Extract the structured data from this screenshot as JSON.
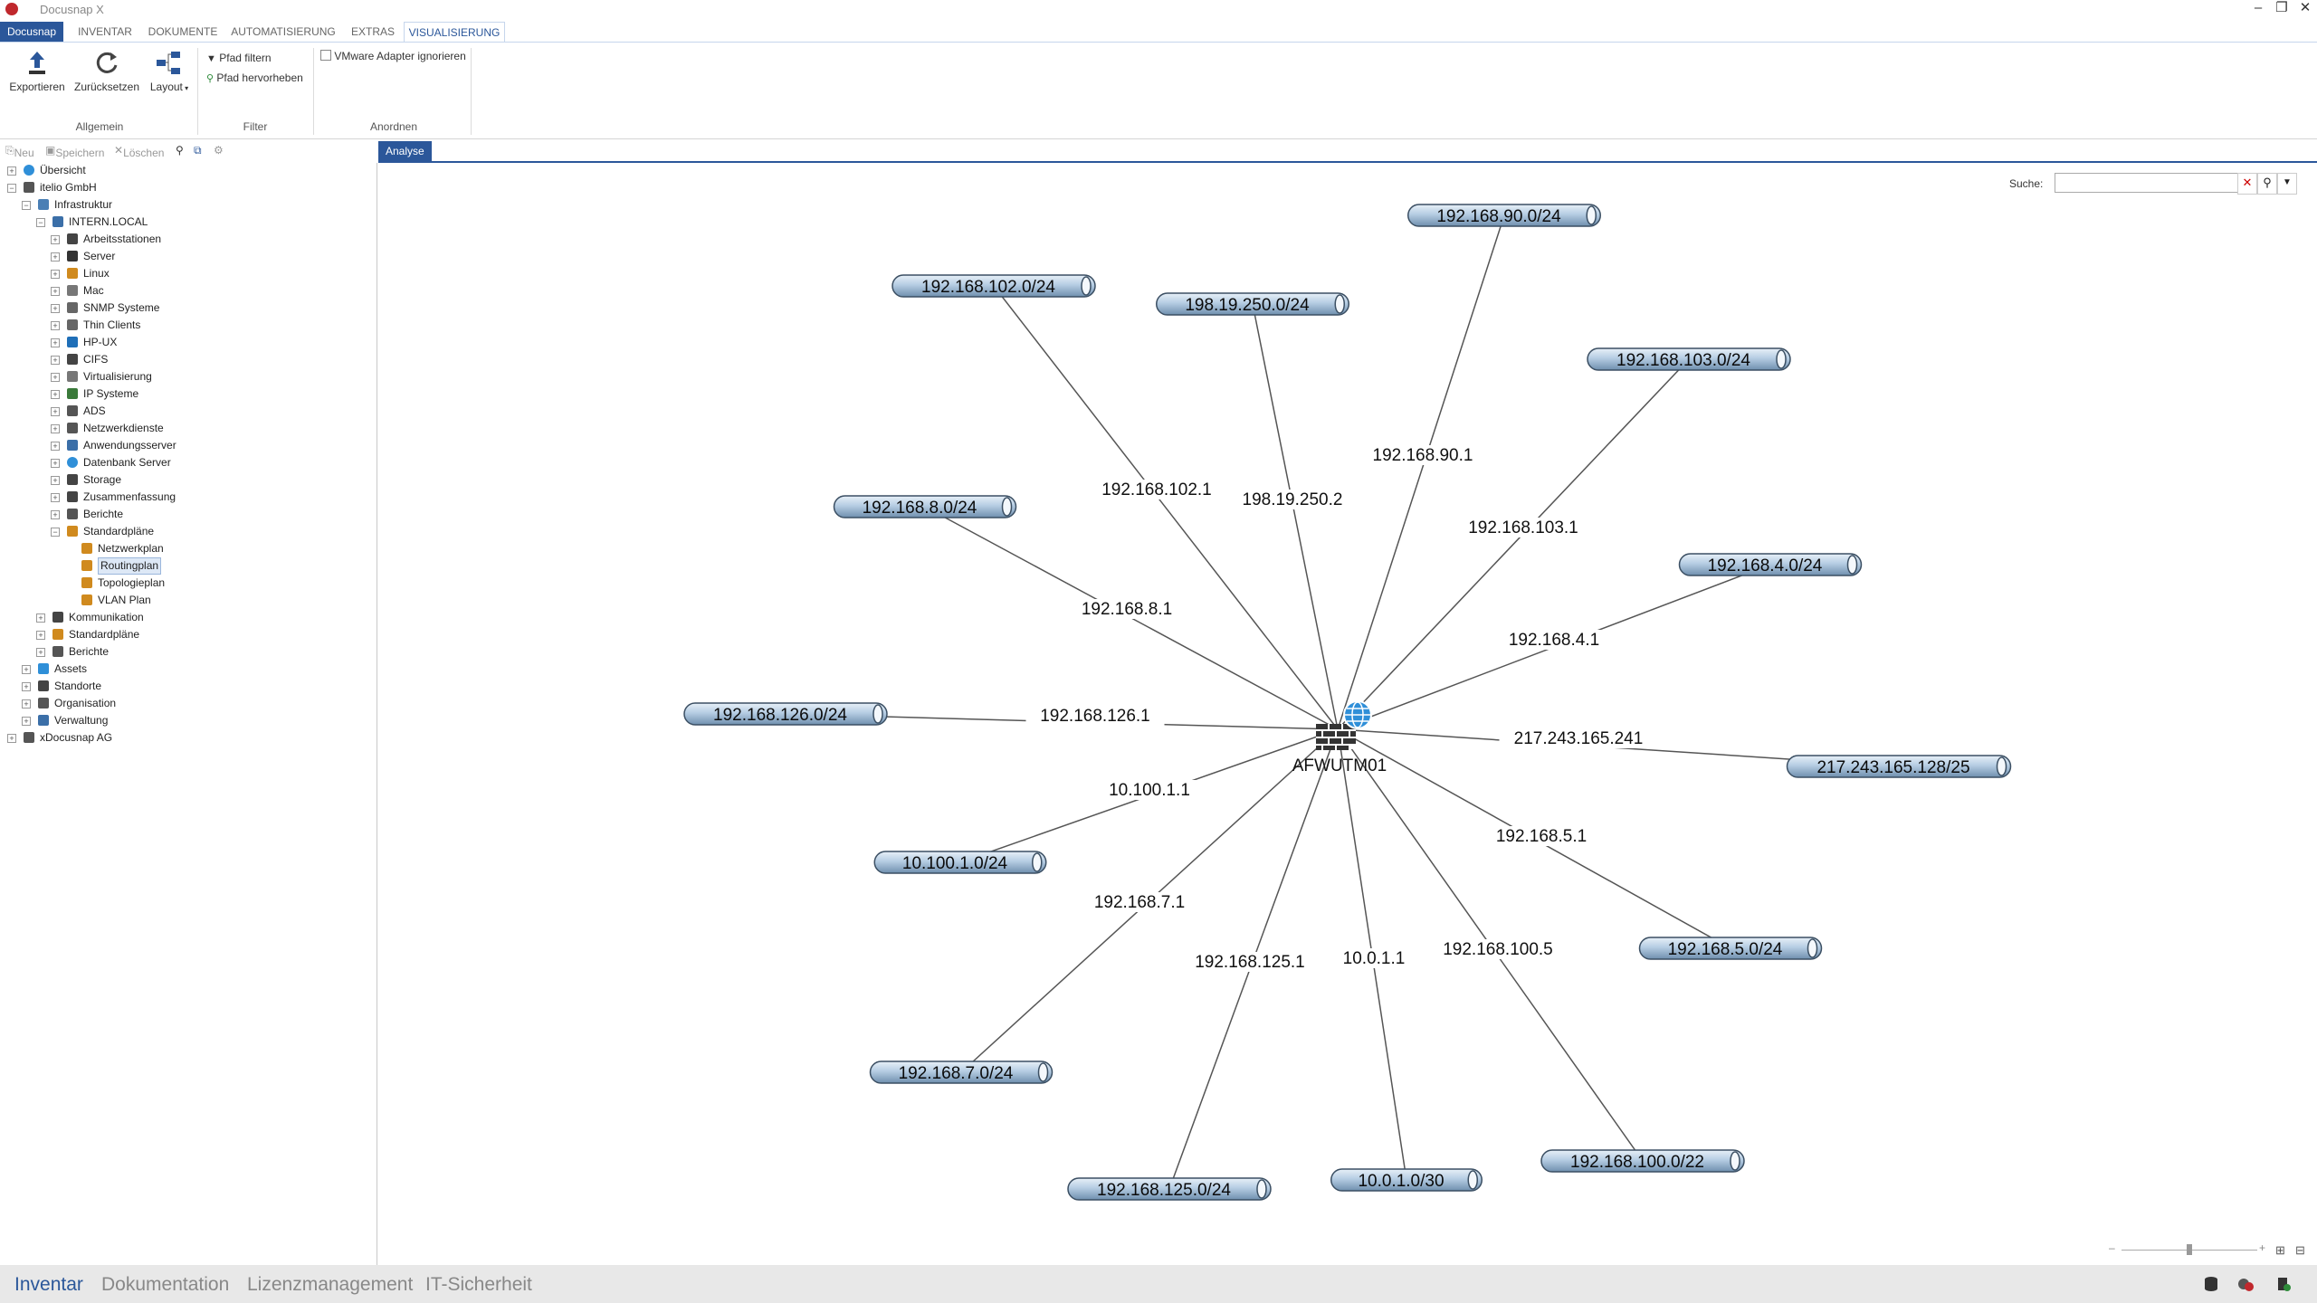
{
  "window": {
    "title": "Docusnap X"
  },
  "ribbon": {
    "tabs": [
      "Docusnap",
      "INVENTAR",
      "DOKUMENTE",
      "AUTOMATISIERUNG",
      "EXTRAS",
      "VISUALISIERUNG"
    ],
    "active_tab": "VISUALISIERUNG",
    "export_label": "Exportieren",
    "reset_label": "Zurücksetzen",
    "layout_label": "Layout",
    "filter_path_label": "Pfad filtern",
    "highlight_path_label": "Pfad hervorheben",
    "vmware_label": "VMware Adapter ignorieren",
    "vmware_checked": false,
    "group_general": "Allgemein",
    "group_filter": "Filter",
    "group_arrange": "Anordnen"
  },
  "tree_toolbar": {
    "new": "Neu",
    "save": "Speichern",
    "delete": "Löschen"
  },
  "tree": [
    {
      "label": "Übersicht",
      "icon": "globe-icon",
      "level": 0,
      "exp": "+"
    },
    {
      "label": "itelio GmbH",
      "icon": "building-icon",
      "level": 0,
      "exp": "-"
    },
    {
      "label": "Infrastruktur",
      "icon": "network-icon",
      "level": 1,
      "exp": "-"
    },
    {
      "label": "INTERN.LOCAL",
      "icon": "domain-icon",
      "level": 2,
      "exp": "-"
    },
    {
      "label": "Arbeitsstationen",
      "icon": "workstation-icon",
      "level": 3,
      "exp": "+"
    },
    {
      "label": "Server",
      "icon": "server-icon",
      "level": 3,
      "exp": "+"
    },
    {
      "label": "Linux",
      "icon": "linux-icon",
      "level": 3,
      "exp": "+"
    },
    {
      "label": "Mac",
      "icon": "mac-icon",
      "level": 3,
      "exp": "+"
    },
    {
      "label": "SNMP Systeme",
      "icon": "snmp-icon",
      "level": 3,
      "exp": "+"
    },
    {
      "label": "Thin Clients",
      "icon": "thin-client-icon",
      "level": 3,
      "exp": "+"
    },
    {
      "label": "HP-UX",
      "icon": "hp-icon",
      "level": 3,
      "exp": "+"
    },
    {
      "label": "CIFS",
      "icon": "cifs-icon",
      "level": 3,
      "exp": "+"
    },
    {
      "label": "Virtualisierung",
      "icon": "virtualization-icon",
      "level": 3,
      "exp": "+"
    },
    {
      "label": "IP Systeme",
      "icon": "ip-icon",
      "level": 3,
      "exp": "+"
    },
    {
      "label": "ADS",
      "icon": "ads-icon",
      "level": 3,
      "exp": "+"
    },
    {
      "label": "Netzwerkdienste",
      "icon": "network-services-icon",
      "level": 3,
      "exp": "+"
    },
    {
      "label": "Anwendungsserver",
      "icon": "app-server-icon",
      "level": 3,
      "exp": "+"
    },
    {
      "label": "Datenbank Server",
      "icon": "database-icon",
      "level": 3,
      "exp": "+"
    },
    {
      "label": "Storage",
      "icon": "storage-icon",
      "level": 3,
      "exp": "+"
    },
    {
      "label": "Zusammenfassung",
      "icon": "summary-icon",
      "level": 3,
      "exp": "+"
    },
    {
      "label": "Berichte",
      "icon": "report-icon",
      "level": 3,
      "exp": "+"
    },
    {
      "label": "Standardpläne",
      "icon": "plan-icon",
      "level": 3,
      "exp": "-"
    },
    {
      "label": "Netzwerkplan",
      "icon": "plan-icon",
      "level": 4,
      "exp": ""
    },
    {
      "label": "Routingplan",
      "icon": "plan-icon",
      "level": 4,
      "exp": "",
      "selected": true
    },
    {
      "label": "Topologieplan",
      "icon": "plan-icon",
      "level": 4,
      "exp": ""
    },
    {
      "label": "VLAN Plan",
      "icon": "plan-icon",
      "level": 4,
      "exp": ""
    },
    {
      "label": "Kommunikation",
      "icon": "share-icon",
      "level": 2,
      "exp": "+"
    },
    {
      "label": "Standardpläne",
      "icon": "plan-icon",
      "level": 2,
      "exp": "+"
    },
    {
      "label": "Berichte",
      "icon": "report-icon",
      "level": 2,
      "exp": "+"
    },
    {
      "label": "Assets",
      "icon": "assets-icon",
      "level": 1,
      "exp": "+"
    },
    {
      "label": "Standorte",
      "icon": "location-icon",
      "level": 1,
      "exp": "+"
    },
    {
      "label": "Organisation",
      "icon": "organization-icon",
      "level": 1,
      "exp": "+"
    },
    {
      "label": "Verwaltung",
      "icon": "admin-icon",
      "level": 1,
      "exp": "+"
    },
    {
      "label": "xDocusnap AG",
      "icon": "building-icon",
      "level": 0,
      "exp": "+"
    }
  ],
  "content": {
    "tab": "Analyse",
    "search_label": "Suche:",
    "search_value": ""
  },
  "diagram": {
    "center": {
      "label": "AFWUTM01"
    },
    "links": [
      {
        "network": "192.168.90.0/24",
        "gateway": "192.168.90.1"
      },
      {
        "network": "192.168.102.0/24",
        "gateway": "192.168.102.1"
      },
      {
        "network": "198.19.250.0/24",
        "gateway": "198.19.250.2"
      },
      {
        "network": "192.168.103.0/24",
        "gateway": "192.168.103.1"
      },
      {
        "network": "192.168.8.0/24",
        "gateway": "192.168.8.1"
      },
      {
        "network": "192.168.4.0/24",
        "gateway": "192.168.4.1"
      },
      {
        "network": "192.168.126.0/24",
        "gateway": "192.168.126.1"
      },
      {
        "network": "217.243.165.128/25",
        "gateway": "217.243.165.241"
      },
      {
        "network": "10.100.1.0/24",
        "gateway": "10.100.1.1"
      },
      {
        "network": "192.168.5.0/24",
        "gateway": "192.168.5.1"
      },
      {
        "network": "192.168.7.0/24",
        "gateway": "192.168.7.1"
      },
      {
        "network": "192.168.125.0/24",
        "gateway": "192.168.125.1"
      },
      {
        "network": "10.0.1.0/30",
        "gateway": "10.0.1.1"
      },
      {
        "network": "192.168.100.0/22",
        "gateway": "192.168.100.5"
      }
    ]
  },
  "bottom_tabs": [
    "Inventar",
    "Dokumentation",
    "Lizenzmanagement",
    "IT-Sicherheit"
  ],
  "bottom_active": "Inventar",
  "colors": {
    "accent": "#2b579a",
    "pipe": "#b9cfe3",
    "line": "#555555"
  }
}
